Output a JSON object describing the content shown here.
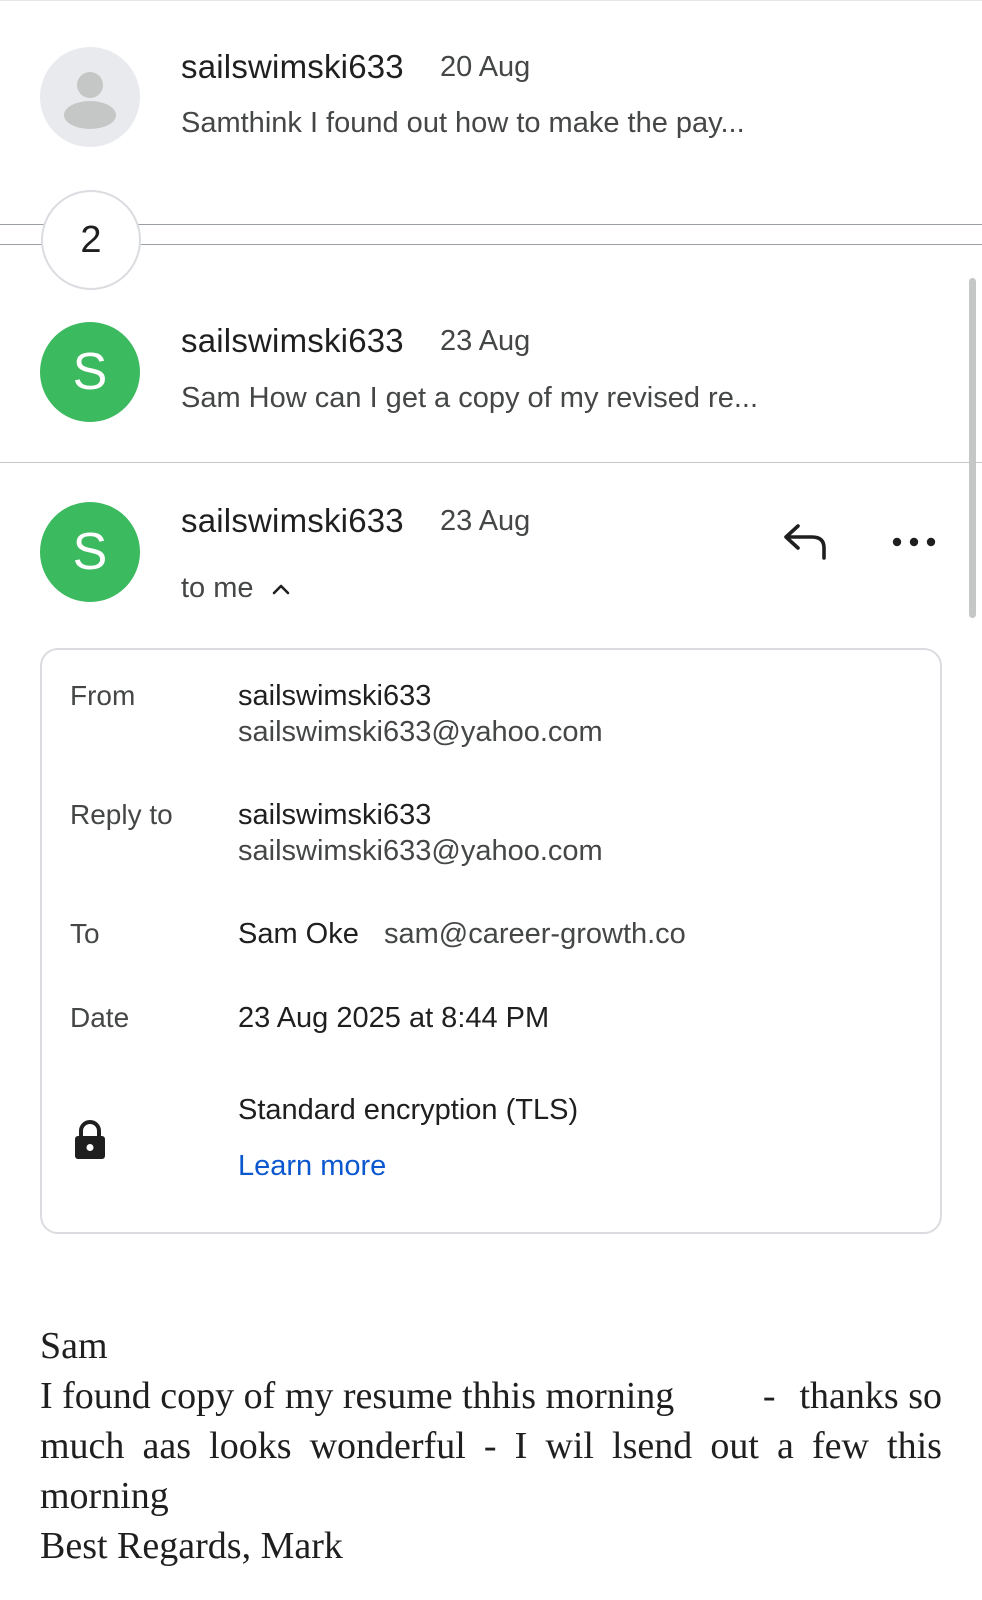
{
  "thread": [
    {
      "sender": "sailswimski633",
      "date": "20 Aug",
      "snippet": "Samthink I found out how to make the pay...",
      "avatar": "generic-person-icon"
    },
    {
      "sender": "sailswimski633",
      "date": "23 Aug",
      "snippet": "Sam How can I get a copy of my revised re...",
      "avatar_letter": "S"
    }
  ],
  "collapsed_count": "2",
  "open_message": {
    "sender": "sailswimski633",
    "date": "23 Aug",
    "avatar_letter": "S",
    "recipient_summary": "to me",
    "details": {
      "from_label": "From",
      "from_name": "sailswimski633",
      "from_email": "sailswimski633@yahoo.com",
      "reply_to_label": "Reply to",
      "reply_to_name": "sailswimski633",
      "reply_to_email": "sailswimski633@yahoo.com",
      "to_label": "To",
      "to_name": "Sam Oke",
      "to_email": "sam@career-growth.co",
      "date_label": "Date",
      "date_value": "23 Aug 2025 at 8:44 PM",
      "encryption": "Standard encryption (TLS)",
      "learn_more": "Learn more"
    },
    "body": {
      "greeting": "Sam",
      "line1_a": "I found copy of my resume thhis morning",
      "line1_b": "-",
      "line1_c": "thanks so",
      "line2_a": "much",
      "line2_b": "aas",
      "line2_c": "looks",
      "line2_d": "wonderful",
      "line2_e": "-",
      "line2_f": "I",
      "line2_g": "wil",
      "line2_h": "lsend",
      "line2_i": "out",
      "line2_j": "a",
      "line2_k": "few",
      "line2_l": "this",
      "line3": "morning",
      "signoff": "Best Regards, Mark"
    }
  },
  "icons": {
    "reply": "reply-arrow-icon",
    "more": "more-horizontal-icon",
    "collapse": "chevron-up-icon",
    "lock": "lock-icon"
  },
  "colors": {
    "avatar_green": "#3cba5f",
    "link_blue": "#0b57d0"
  }
}
